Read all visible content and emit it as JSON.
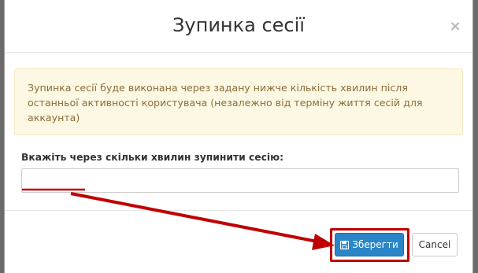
{
  "modal": {
    "title": "Зупинка сесії",
    "close_glyph": "×",
    "alert_text": "Зупинка сесії буде виконана через задану нижче кількість хвилин після останньої активності користувача (незалежно від терміну життя сесій для аккаунта)",
    "field_label": "Вкажіть через скільки хвилин зупинити сесію:",
    "field_value": "",
    "save_label": "Зберегти",
    "cancel_label": "Cancel"
  },
  "icons": {
    "save": "floppy-disk-icon",
    "close": "close-icon"
  },
  "colors": {
    "primary": "#2a86c9",
    "alert_bg": "#fcf8e3",
    "alert_text": "#8a6d3b",
    "annotation": "#c00000"
  }
}
